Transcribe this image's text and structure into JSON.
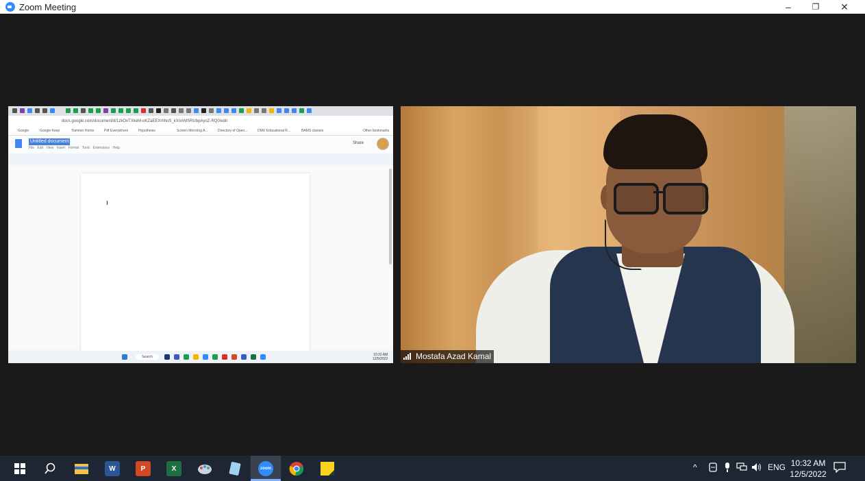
{
  "window": {
    "title": "Zoom Meeting",
    "minimize_label": "–",
    "restore_label": "❐",
    "close_label": "✕"
  },
  "shared_screen": {
    "url": "docs.google.com/document/d/1zkOvTXkeM-oKZaEEXrhhoS_kXnAMSRUbpAyoZ-RQ0/edit",
    "bookmarks": [
      "Google",
      "Google Keep",
      "Yammer Home",
      "Pdf Everywhere",
      "Hypothesis",
      "Screen Mirroring A...",
      "Directory of Open...",
      "DMU Educational R...",
      "BAMS classes",
      "Other bookmarks"
    ],
    "doc_title": "Untitled document",
    "menu": "File Edit View Insert Format Tools Extensions Help",
    "share_label": "Share",
    "inner_search": "Search",
    "inner_time": "10:32 AM",
    "inner_date": "12/5/2022"
  },
  "participant": {
    "name": "Mostafa Azad Kamal",
    "icons": [
      "signal-strength-icon"
    ]
  },
  "taskbar": {
    "apps": [
      "windows-start-icon",
      "search-icon",
      "file-explorer-icon",
      "word-icon",
      "powerpoint-icon",
      "excel-icon",
      "paint-icon",
      "notepad-icon",
      "zoom-icon",
      "chrome-icon",
      "sticky-notes-icon"
    ],
    "tray_chevron": "^",
    "language": "ENG",
    "time": "10:32 AM",
    "date": "12/5/2022",
    "colors": {
      "word": "#2b5797",
      "powerpoint": "#d24726",
      "excel": "#1d6f42",
      "zoom": "#2d8cff",
      "sticky": "#f8d21f"
    }
  }
}
